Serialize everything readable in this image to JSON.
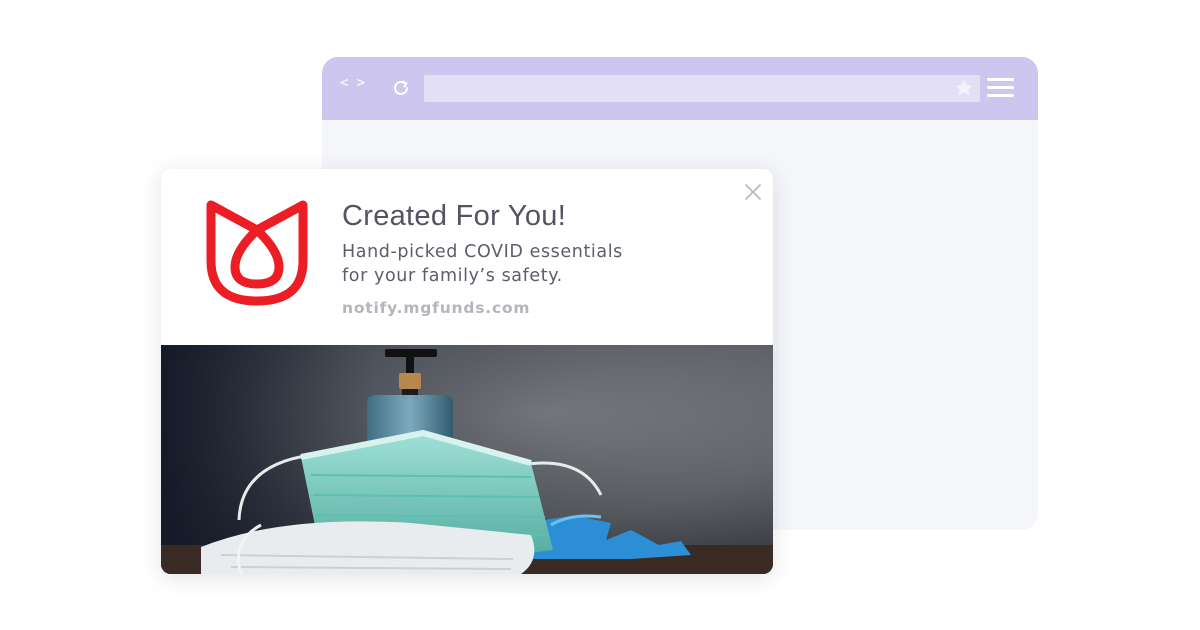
{
  "browser": {
    "nav_arrows": [
      "<",
      ">"
    ],
    "icons": [
      "back-icon",
      "forward-icon",
      "reload-icon",
      "star-icon",
      "menu-icon"
    ],
    "colors": {
      "toolbar": "#cdc6ee",
      "address_bar": "#e3e0f5",
      "viewport": "#f5f6fa"
    }
  },
  "notification": {
    "title": "Created For You!",
    "body_line1": "Hand-picked COVID essentials",
    "body_line2": "for your family’s safety.",
    "domain": "notify.mgfunds.com",
    "icons": [
      "brand-logo-icon",
      "close-icon"
    ],
    "colors": {
      "logo": "#ea1e24",
      "title": "#525463",
      "body": "#5b5d6b",
      "domain": "#b4b5bd"
    },
    "image": "face masks, hand sanitizer bottle and blue gloves"
  }
}
